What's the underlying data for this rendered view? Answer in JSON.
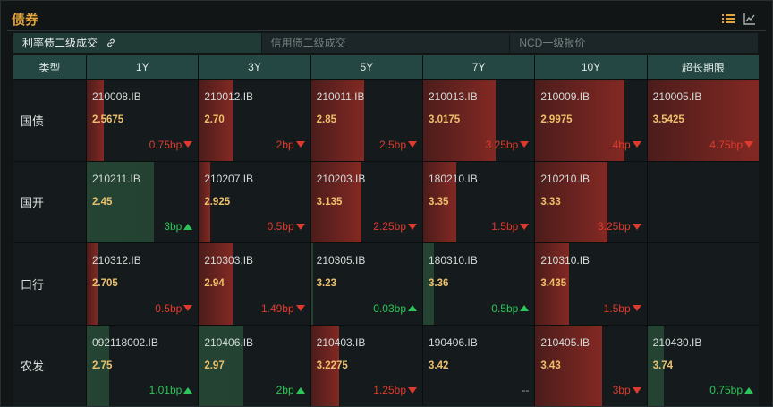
{
  "title": "债券",
  "icons": {
    "list": "list-icon",
    "chart": "line-chart-icon",
    "link": "link-icon"
  },
  "colors": {
    "accent": "#e3a43b",
    "up": "#2ec45a",
    "down": "#e03a2e",
    "header": "#244743"
  },
  "tabs": [
    {
      "label": "利率债二级成交",
      "active": true
    },
    {
      "label": "信用债二级成交",
      "active": false
    },
    {
      "label": "NCD一级报价",
      "active": false
    }
  ],
  "table": {
    "columns": [
      "类型",
      "1Y",
      "3Y",
      "5Y",
      "7Y",
      "10Y",
      "超长期限"
    ],
    "rows": [
      {
        "type": "国债",
        "cells": [
          {
            "code": "210008.IB",
            "yield": "2.5675",
            "change": "0.75bp",
            "dir": "down",
            "level": 0.15
          },
          {
            "code": "210012.IB",
            "yield": "2.70",
            "change": "2bp",
            "dir": "down",
            "level": 0.3
          },
          {
            "code": "210011.IB",
            "yield": "2.85",
            "change": "2.5bp",
            "dir": "down",
            "level": 0.48
          },
          {
            "code": "210013.IB",
            "yield": "3.0175",
            "change": "3.25bp",
            "dir": "down",
            "level": 0.65
          },
          {
            "code": "210009.IB",
            "yield": "2.9975",
            "change": "4bp",
            "dir": "down",
            "level": 0.8
          },
          {
            "code": "210005.IB",
            "yield": "3.5425",
            "change": "4.75bp",
            "dir": "down",
            "level": 1.0
          }
        ]
      },
      {
        "type": "国开",
        "cells": [
          {
            "code": "210211.IB",
            "yield": "2.45",
            "change": "3bp",
            "dir": "up",
            "level": 0.6
          },
          {
            "code": "210207.IB",
            "yield": "2.925",
            "change": "0.5bp",
            "dir": "down",
            "level": 0.1
          },
          {
            "code": "210203.IB",
            "yield": "3.135",
            "change": "2.25bp",
            "dir": "down",
            "level": 0.45
          },
          {
            "code": "180210.IB",
            "yield": "3.35",
            "change": "1.5bp",
            "dir": "down",
            "level": 0.3
          },
          {
            "code": "210210.IB",
            "yield": "3.33",
            "change": "3.25bp",
            "dir": "down",
            "level": 0.65
          },
          null
        ]
      },
      {
        "type": "口行",
        "cells": [
          {
            "code": "210312.IB",
            "yield": "2.705",
            "change": "0.5bp",
            "dir": "down",
            "level": 0.1
          },
          {
            "code": "210303.IB",
            "yield": "2.94",
            "change": "1.49bp",
            "dir": "down",
            "level": 0.3
          },
          {
            "code": "210305.IB",
            "yield": "3.23",
            "change": "0.03bp",
            "dir": "up",
            "level": 0.02
          },
          {
            "code": "180310.IB",
            "yield": "3.36",
            "change": "0.5bp",
            "dir": "up",
            "level": 0.1
          },
          {
            "code": "210310.IB",
            "yield": "3.435",
            "change": "1.5bp",
            "dir": "down",
            "level": 0.3
          },
          null
        ]
      },
      {
        "type": "农发",
        "cells": [
          {
            "code": "092118002.IB",
            "yield": "2.75",
            "change": "1.01bp",
            "dir": "up",
            "level": 0.2
          },
          {
            "code": "210406.IB",
            "yield": "2.97",
            "change": "2bp",
            "dir": "up",
            "level": 0.4
          },
          {
            "code": "210403.IB",
            "yield": "3.2275",
            "change": "1.25bp",
            "dir": "down",
            "level": 0.25
          },
          {
            "code": "190406.IB",
            "yield": "3.42",
            "change": "--",
            "dir": "flat",
            "level": 0
          },
          {
            "code": "210405.IB",
            "yield": "3.43",
            "change": "3bp",
            "dir": "down",
            "level": 0.6
          },
          {
            "code": "210430.IB",
            "yield": "3.74",
            "change": "0.75bp",
            "dir": "up",
            "level": 0.15
          }
        ]
      }
    ]
  }
}
